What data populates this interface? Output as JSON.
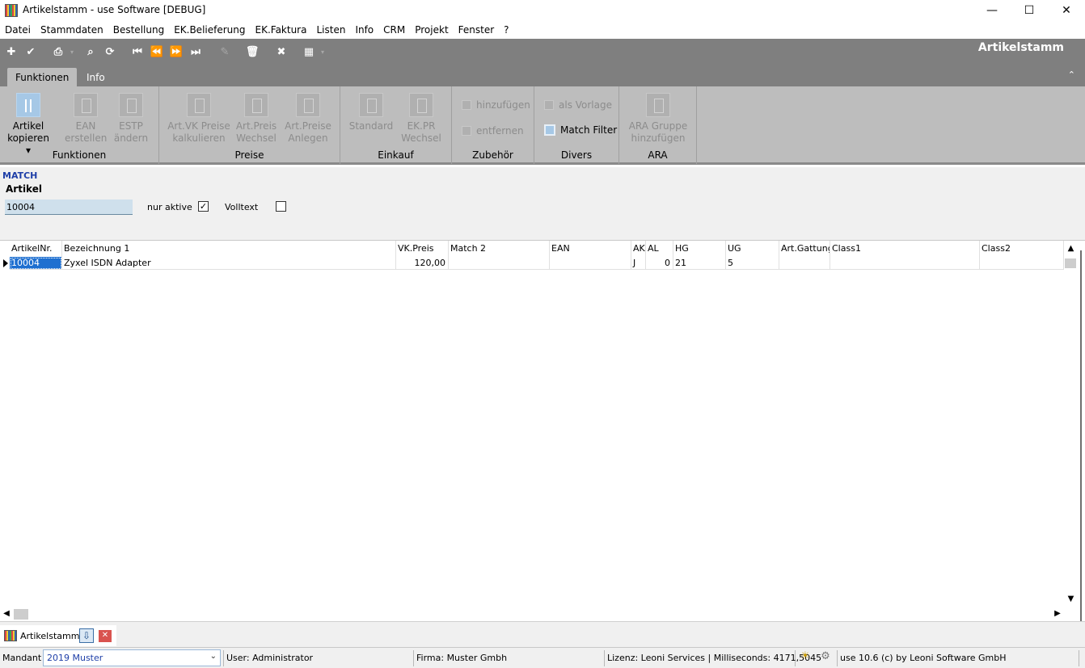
{
  "window": {
    "title": "Artikelstamm - use Software [DEBUG]"
  },
  "menu": [
    "Datei",
    "Stammdaten",
    "Bestellung",
    "EK.Belieferung",
    "EK.Faktura",
    "Listen",
    "Info",
    "CRM",
    "Projekt",
    "Fenster",
    "?"
  ],
  "toolbar": {
    "page_label": "Artikelstamm"
  },
  "tabs": {
    "funktionen": "Funktionen",
    "info": "Info"
  },
  "ribbon": {
    "groups": {
      "funktionen": "Funktionen",
      "preise": "Preise",
      "einkauf": "Einkauf",
      "zubehoer": "Zubehör",
      "divers": "Divers",
      "ara": "ARA"
    },
    "buttons": {
      "artikel_kopieren_1": "Artikel",
      "artikel_kopieren_2": "kopieren ▾",
      "ean_1": "EAN",
      "ean_2": "erstellen",
      "estp_1": "ESTP",
      "estp_2": "ändern",
      "artvk_1": "Art.VK Preise",
      "artvk_2": "kalkulieren",
      "artpreis_1": "Art.Preis",
      "artpreis_2": "Wechsel",
      "artpreise_1": "Art.Preise",
      "artpreise_2": "Anlegen",
      "standard": "Standard",
      "ekpr_1": "EK.PR",
      "ekpr_2": "Wechsel",
      "hinzufuegen": "hinzufügen",
      "entfernen": "entfernen",
      "als_vorlage": "als Vorlage",
      "match_filter": "Match Filter",
      "ara_1": "ARA Gruppe",
      "ara_2": "hinzufügen"
    }
  },
  "filter": {
    "match_label": "MATCH",
    "artikel_label": "Artikel",
    "search_value": "10004",
    "nur_aktive_label": "nur aktive",
    "nur_aktive_checked": true,
    "volltext_label": "Volltext",
    "volltext_checked": false
  },
  "grid": {
    "columns": [
      "ArtikelNr.",
      "Bezeichnung 1",
      "VK.Preis",
      "Match 2",
      "EAN",
      "AK",
      "AL",
      "HG",
      "UG",
      "Art.Gattung",
      "Class1",
      "Class2"
    ],
    "rows": [
      {
        "artikelnr": "10004",
        "bezeichnung": "Zyxel ISDN Adapter",
        "vkpreis": "120,00",
        "match2": "",
        "ean": "",
        "ak": "J",
        "al": "0",
        "hg": "21",
        "ug": "5",
        "gattung": "",
        "class1": "",
        "class2": ""
      }
    ]
  },
  "doc_tab": {
    "label": "Artikelstamm"
  },
  "status": {
    "mandant_label": "Mandant",
    "mandant_value": "2019 Muster",
    "user": "User: Administrator",
    "firma": "Firma: Muster Gmbh",
    "lizenz": "Lizenz: Leoni Services | Milliseconds: 4171,5045",
    "version": "use 10.6 (c) by Leoni Software GmbH"
  }
}
